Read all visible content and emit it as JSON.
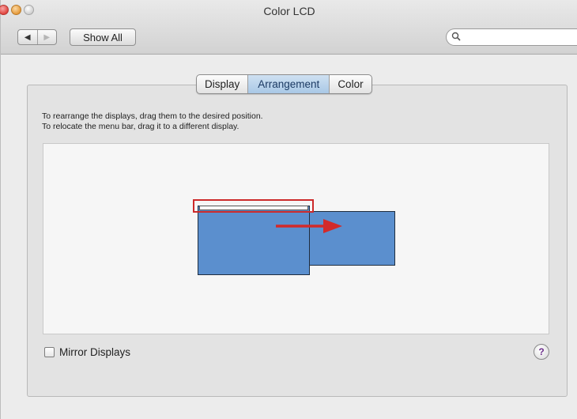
{
  "window": {
    "title": "Color LCD"
  },
  "toolbar": {
    "back_glyph": "◀",
    "forward_glyph": "▶",
    "show_all_label": "Show All",
    "search_placeholder": ""
  },
  "tabs": [
    {
      "label": "Display",
      "active": false
    },
    {
      "label": "Arrangement",
      "active": true
    },
    {
      "label": "Color",
      "active": false
    }
  ],
  "instructions": {
    "line1": "To rearrange the displays, drag them to the desired position.",
    "line2": "To relocate the menu bar, drag it to a different display."
  },
  "arrangement": {
    "displays": [
      "main-display",
      "secondary-display"
    ],
    "display_color": "#5b8fce",
    "highlight_color": "#cc2a2a"
  },
  "mirror": {
    "label": "Mirror Displays",
    "checked": false
  },
  "help": {
    "glyph": "?"
  },
  "colors": {
    "accent": "#a9c8e6",
    "close": "#e0443e",
    "minimize": "#e59a3b"
  }
}
